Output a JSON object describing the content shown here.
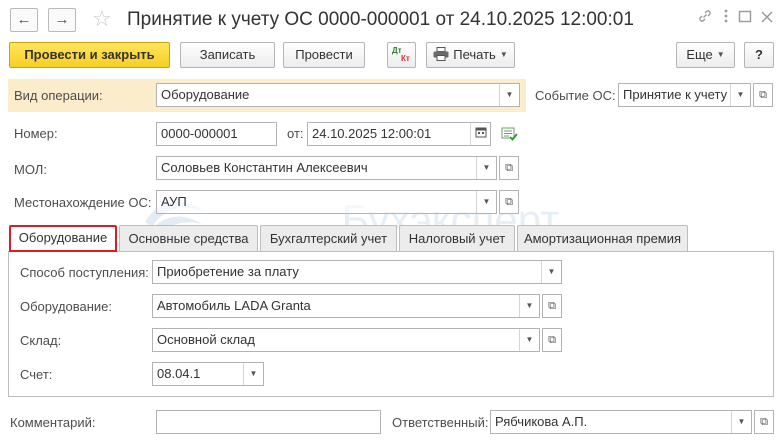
{
  "window": {
    "title": "Принятие к учету ОС 0000-000001 от 24.10.2025 12:00:01",
    "back_icon": "←",
    "forward_icon": "→",
    "star_icon": "☆",
    "link_icon": "🔗",
    "more_icon": "⋮",
    "maximize_icon": "☐",
    "close_icon": "✕"
  },
  "toolbar": {
    "post_close": "Провести и закрыть",
    "save": "Записать",
    "post": "Провести",
    "dtkt_top": "Дт",
    "dtkt_bottom": "Кт",
    "print": "Печать",
    "more": "Еще",
    "help": "?"
  },
  "form": {
    "operation_label": "Вид операции:",
    "operation_value": "Оборудование",
    "event_label": "Событие ОС:",
    "event_value": "Принятие к учету",
    "number_label": "Номер:",
    "number_value": "0000-000001",
    "date_label": "от:",
    "date_value": "24.10.2025 12:00:01",
    "mol_label": "МОЛ:",
    "mol_value": "Соловьев Константин Алексеевич",
    "location_label": "Местонахождение ОС:",
    "location_value": "АУП"
  },
  "watermark": "Бухэксперт",
  "tabs": [
    {
      "label": "Оборудование"
    },
    {
      "label": "Основные средства"
    },
    {
      "label": "Бухгалтерский учет"
    },
    {
      "label": "Налоговый учет"
    },
    {
      "label": "Амортизационная премия"
    }
  ],
  "equipment_tab": {
    "receipt_method_label": "Способ поступления:",
    "receipt_method_value": "Приобретение за плату",
    "equipment_label": "Оборудование:",
    "equipment_value": "Автомобиль LADA Granta",
    "warehouse_label": "Склад:",
    "warehouse_value": "Основной склад",
    "account_label": "Счет:",
    "account_value": "08.04.1"
  },
  "footer": {
    "comment_label": "Комментарий:",
    "comment_value": "",
    "responsible_label": "Ответственный:",
    "responsible_value": "Рябчикова А.П."
  },
  "colors": {
    "primary_button": "#f7cf23",
    "operation_highlight": "#fbeccb",
    "active_tab_border": "#e11b22"
  }
}
